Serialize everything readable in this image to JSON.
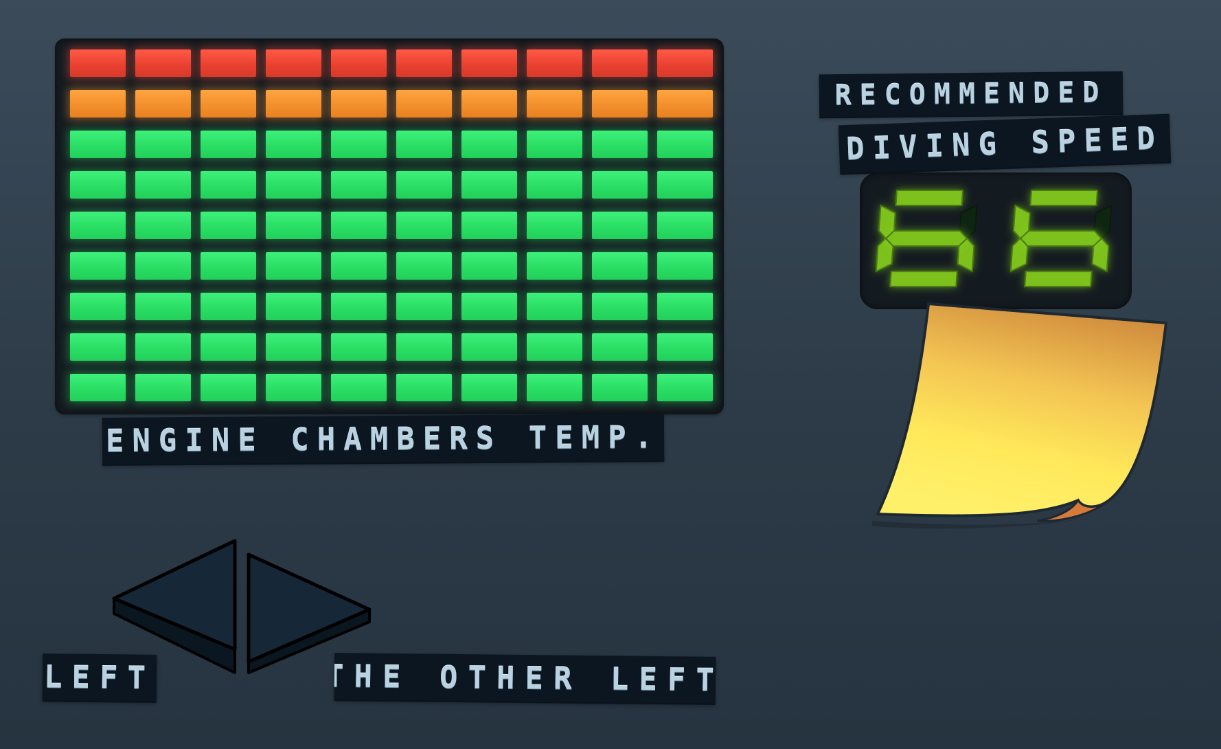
{
  "engine_panel": {
    "label": "ENGINE CHAMBERS TEMP.",
    "columns": 10,
    "rows": [
      "red",
      "orange",
      "green",
      "green",
      "green",
      "green",
      "green",
      "green",
      "green"
    ],
    "colors": {
      "red": "#e8402f",
      "orange": "#f28e2c",
      "green": "#29dd63"
    }
  },
  "speed_panel": {
    "label_line1": "RECOMMENDED",
    "label_line2": "DIVING SPEED",
    "value": "66",
    "digit_color": "#7dc11c"
  },
  "controls": {
    "left_label": "LEFT",
    "right_label": "THE OTHER LEFT",
    "left_arrow_icon": "triangle-left-icon",
    "right_arrow_icon": "triangle-right-icon"
  },
  "sticky_note": {
    "color": "#ffe95a"
  }
}
